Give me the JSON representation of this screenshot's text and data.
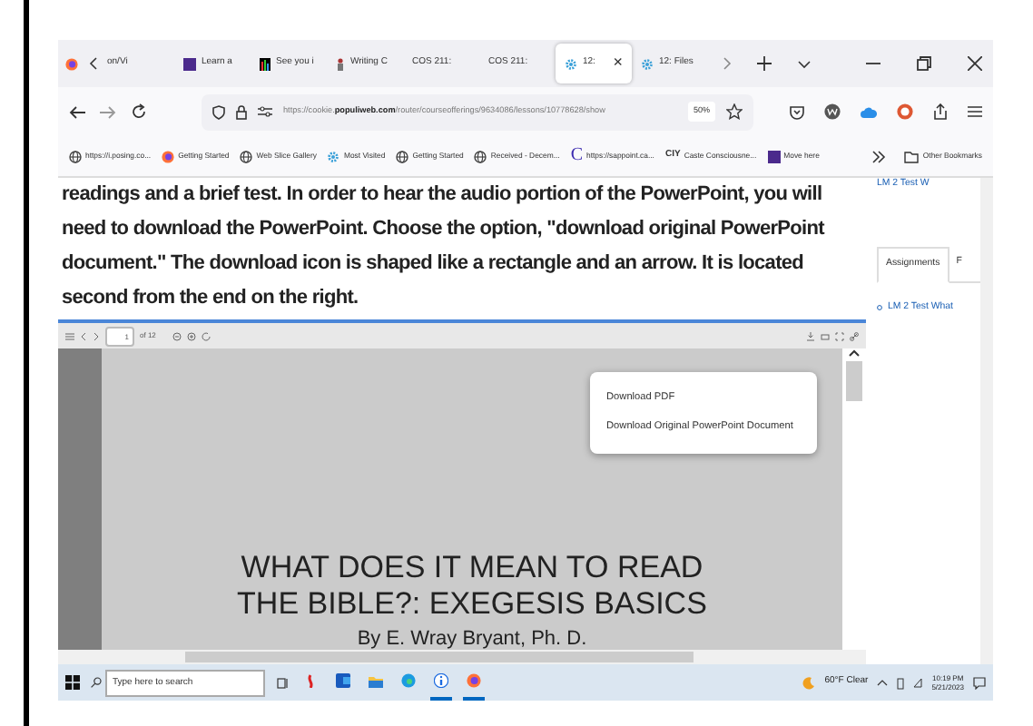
{
  "tabs": [
    {
      "label": "on/Vi",
      "kind": "none",
      "selected": false
    },
    {
      "label": "Learn a",
      "kind": "purple",
      "selected": false
    },
    {
      "label": "See you i",
      "kind": "bars",
      "selected": false
    },
    {
      "label": "Writing C",
      "kind": "person",
      "selected": false
    },
    {
      "label": "COS 211:",
      "kind": "none",
      "selected": false
    },
    {
      "label": "COS 211:",
      "kind": "none",
      "selected": false
    },
    {
      "label": "12:",
      "kind": "gear",
      "selected": true,
      "close": "×"
    },
    {
      "label": "12: Files",
      "kind": "gear",
      "selected": false
    }
  ],
  "address_bar": {
    "url_host": "https://cookie.",
    "url_domain": "populiweb.com",
    "url_path": "/router/courseofferings/9634086/lessons/10778628/show",
    "zoom": "50%"
  },
  "bookmarks": [
    {
      "label": "https://i.posing.co...",
      "kind": "globe"
    },
    {
      "label": "Getting Started",
      "kind": "firefox"
    },
    {
      "label": "Web Slice Gallery",
      "kind": "globe"
    },
    {
      "label": "Most Visited",
      "kind": "gear"
    },
    {
      "label": "Getting Started",
      "kind": "globe"
    },
    {
      "label": "Received - Decem...",
      "kind": "globe"
    },
    {
      "label": "https://sappoint.ca...",
      "kind": "letter",
      "mark": "C"
    },
    {
      "label": "Caste Consciousne...",
      "kind": "letter",
      "mark": "CIY"
    },
    {
      "label": "Move here",
      "kind": "purple"
    }
  ],
  "other_bookmarks": "Other Bookmarks",
  "instructions": "readings and a brief test. In order to hear the audio portion of the PowerPoint, you will need to download the PowerPoint. Choose the option, \"download original PowerPoint document.\" The download icon is shaped like a rectangle and an arrow. It is located second from the end on the right.",
  "viewer": {
    "page": "1",
    "page_count": "of 12",
    "menu": [
      "Download PDF",
      "Download Original PowerPoint Document"
    ],
    "slide": {
      "title": "WHAT DOES IT MEAN TO READ THE BIBLE?: EXEGESIS BASICS",
      "author": "By E. Wray Bryant, Ph. D."
    }
  },
  "sidebar": {
    "top_link": "LM 2 Test W",
    "tabs": [
      {
        "label": "Assignments",
        "selected": true
      },
      {
        "label": "F",
        "selected": false
      }
    ],
    "items": [
      "LM 2 Test What"
    ]
  },
  "taskbar": {
    "search": {
      "placeholder": "Type here to search"
    },
    "apps": [
      {
        "kind": "pdf",
        "running": false
      },
      {
        "kind": "word",
        "running": false
      },
      {
        "kind": "folder",
        "running": false
      },
      {
        "kind": "edge",
        "running": false
      },
      {
        "kind": "info",
        "running": true
      },
      {
        "kind": "firefox",
        "running": true
      }
    ],
    "weather": "60°F Clear",
    "time": "10:19 PM",
    "date": "5/21/2023"
  }
}
